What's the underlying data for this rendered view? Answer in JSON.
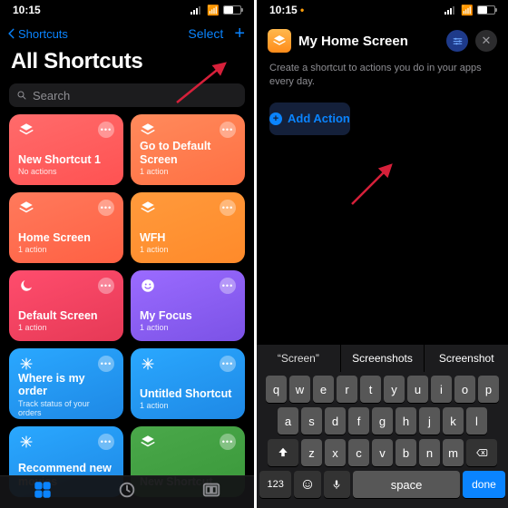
{
  "status": {
    "time": "10:15",
    "recording": "•"
  },
  "left": {
    "back": "Shortcuts",
    "select": "Select",
    "title": "All Shortcuts",
    "search_placeholder": "Search",
    "cards": [
      {
        "name": "New Shortcut 1",
        "sub": "No actions",
        "icon": "layers",
        "bg": "linear-gradient(160deg,#ff6b6b,#ff5252)"
      },
      {
        "name": "Go to Default Screen",
        "sub": "1 action",
        "icon": "layers",
        "bg": "linear-gradient(160deg,#ff8a5c,#ff7043)"
      },
      {
        "name": "Home Screen",
        "sub": "1 action",
        "icon": "layers",
        "bg": "linear-gradient(160deg,#ff7a5c,#ff6043)"
      },
      {
        "name": "WFH",
        "sub": "1 action",
        "icon": "layers",
        "bg": "linear-gradient(160deg,#ff9a3c,#ff8a2a)"
      },
      {
        "name": "Default Screen",
        "sub": "1 action",
        "icon": "moon",
        "bg": "linear-gradient(160deg,#ff4d6d,#e63956)"
      },
      {
        "name": "My Focus",
        "sub": "1 action",
        "icon": "smile",
        "bg": "linear-gradient(160deg,#9b6bff,#7b52e6)"
      },
      {
        "name": "Where is my order",
        "sub": "Track status of your orders",
        "icon": "sparkle",
        "bg": "linear-gradient(160deg,#2aa8ff,#1e88e5)"
      },
      {
        "name": "Untitled Shortcut",
        "sub": "1 action",
        "icon": "sparkle",
        "bg": "linear-gradient(160deg,#2aa8ff,#1e88e5)"
      },
      {
        "name": "Recommend new movies",
        "sub": "",
        "icon": "sparkle",
        "bg": "linear-gradient(160deg,#2aa8ff,#1e88e5)"
      },
      {
        "name": "New Shortcut",
        "sub": "",
        "icon": "layers",
        "bg": "linear-gradient(160deg,#4aa84a,#3a983a)"
      }
    ]
  },
  "right": {
    "title": "My Home Screen",
    "hint": "Create a shortcut to actions you do in your apps every day.",
    "add_action": "Add Action",
    "suggestions": [
      "“Screen”",
      "Screenshots",
      "Screenshot"
    ],
    "keys_r1": [
      "q",
      "w",
      "e",
      "r",
      "t",
      "y",
      "u",
      "i",
      "o",
      "p"
    ],
    "keys_r2": [
      "a",
      "s",
      "d",
      "f",
      "g",
      "h",
      "j",
      "k",
      "l"
    ],
    "keys_r3": [
      "z",
      "x",
      "c",
      "v",
      "b",
      "n",
      "m"
    ],
    "key_123": "123",
    "key_space": "space",
    "key_done": "done"
  }
}
